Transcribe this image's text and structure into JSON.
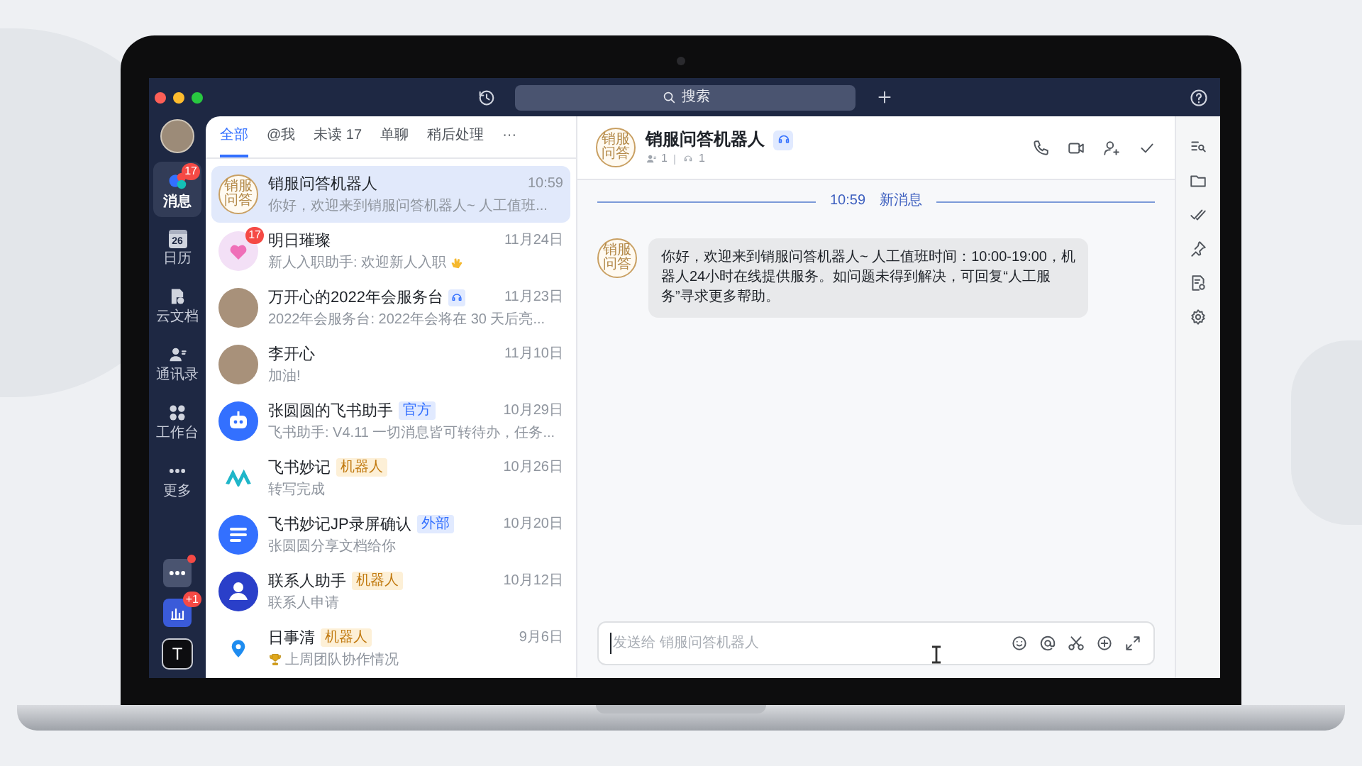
{
  "title_bar": {
    "search_placeholder": "搜索"
  },
  "nav": {
    "items": [
      {
        "label": "消息",
        "kind": "chat",
        "selected": true,
        "badge": "17"
      },
      {
        "label": "日历",
        "kind": "calendar",
        "selected": false,
        "icon_text": "26"
      },
      {
        "label": "云文档",
        "kind": "docs",
        "selected": false
      },
      {
        "label": "通讯录",
        "kind": "contacts",
        "selected": false
      },
      {
        "label": "工作台",
        "kind": "apps",
        "selected": false
      },
      {
        "label": "更多",
        "kind": "more",
        "selected": false
      }
    ],
    "apps": [
      {
        "kind": "dots",
        "dot": true
      },
      {
        "kind": "chart",
        "badge": "+1"
      },
      {
        "kind": "letter",
        "text": "T"
      }
    ]
  },
  "list_tabs": [
    {
      "label": "全部",
      "selected": true
    },
    {
      "label": "@我",
      "selected": false
    },
    {
      "label": "未读 17",
      "selected": false
    },
    {
      "label": "单聊",
      "selected": false
    },
    {
      "label": "稍后处理",
      "selected": false
    },
    {
      "label": "···",
      "selected": false
    }
  ],
  "conversations": [
    {
      "name": "销服问答机器人",
      "time": "10:59",
      "preview": "你好，欢迎来到销服问答机器人~ 人工值班...",
      "avatar": {
        "kind": "text",
        "text": "销服问答"
      },
      "selected": true
    },
    {
      "name": "明日璀璨",
      "time": "11月24日",
      "preview": "新人入职助手: 欢迎新人入职",
      "avatar": {
        "kind": "heart",
        "badge": "17"
      },
      "trail_icon": true,
      "selected": false
    },
    {
      "name": "万开心的2022年会服务台",
      "time": "11月23日",
      "preview": "2022年会服务台: 2022年会将在 30 天后亮...",
      "avatar": {
        "kind": "photo"
      },
      "name_icon": true,
      "selected": false
    },
    {
      "name": "李开心",
      "time": "11月10日",
      "preview": "加油!",
      "avatar": {
        "kind": "photo"
      },
      "selected": false
    },
    {
      "name": "张圆圆的飞书助手",
      "time": "10月29日",
      "preview": "飞书助手: V4.11 一切消息皆可转待办，任务...",
      "avatar": {
        "kind": "robot"
      },
      "tag": {
        "text": "官方",
        "kind": "official"
      },
      "selected": false
    },
    {
      "name": "飞书妙记",
      "time": "10月26日",
      "preview": "转写完成",
      "avatar": {
        "kind": "wave"
      },
      "tag": {
        "text": "机器人",
        "kind": "bot"
      },
      "selected": false
    },
    {
      "name": "飞书妙记JP录屏确认",
      "time": "10月20日",
      "preview": "张圆圆分享文档给你",
      "avatar": {
        "kind": "doc"
      },
      "tag": {
        "text": "外部",
        "kind": "external"
      },
      "selected": false
    },
    {
      "name": "联系人助手",
      "time": "10月12日",
      "preview": "联系人申请",
      "avatar": {
        "kind": "contact"
      },
      "tag": {
        "text": "机器人",
        "kind": "bot"
      },
      "selected": false
    },
    {
      "name": "日事清",
      "time": "9月6日",
      "preview": "上周团队协作情况",
      "avatar": {
        "kind": "pin"
      },
      "tag": {
        "text": "机器人",
        "kind": "bot"
      },
      "lead_icon": true,
      "selected": false
    }
  ],
  "chat": {
    "title": "销服问答机器人",
    "avatar_text": "销服问答",
    "member_count": "1",
    "bot_count": "1",
    "divider": {
      "time": "10:59",
      "label": "新消息"
    },
    "messages": [
      {
        "avatar_text": "销服问答",
        "text": "你好，欢迎来到销服问答机器人~ 人工值班时间：10:00-19:00，机器人24小时在线提供服务。如问题未得到解决，可回复“人工服务”寻求更多帮助。"
      }
    ],
    "input": {
      "placeholder": "发送给 销服问答机器人"
    }
  }
}
